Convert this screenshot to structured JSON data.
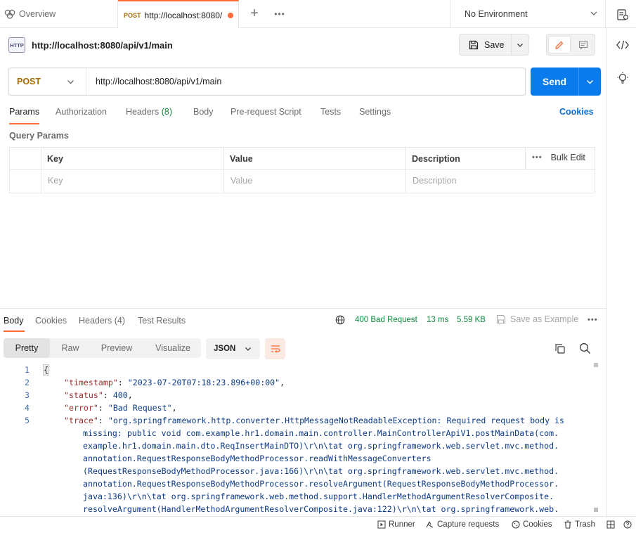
{
  "tabs": {
    "overview_label": "Overview",
    "active_method": "POST",
    "active_url": "http://localhost:8080/",
    "plus": "+",
    "more": "•••"
  },
  "environment": {
    "selected": "No Environment"
  },
  "request": {
    "badge": "HTTP",
    "name": "http://localhost:8080/api/v1/main",
    "save_label": "Save",
    "method": "POST",
    "url": "http://localhost:8080/api/v1/main",
    "send_label": "Send"
  },
  "request_tabs": {
    "params": "Params",
    "authorization": "Authorization",
    "headers": "Headers",
    "headers_count": "(8)",
    "body": "Body",
    "pre_request": "Pre-request Script",
    "tests": "Tests",
    "settings": "Settings",
    "cookies": "Cookies"
  },
  "query_params": {
    "title": "Query Params",
    "col_key": "Key",
    "col_value": "Value",
    "col_description": "Description",
    "bulk_edit": "Bulk Edit",
    "dots": "•••",
    "ph_key": "Key",
    "ph_value": "Value",
    "ph_description": "Description"
  },
  "response_tabs": {
    "body": "Body",
    "cookies": "Cookies",
    "headers": "Headers (4)",
    "test_results": "Test Results"
  },
  "response_meta": {
    "status": "400 Bad Request",
    "time": "13 ms",
    "size": "5.59 KB",
    "save_example": "Save as Example",
    "more": "•••"
  },
  "view_modes": {
    "pretty": "Pretty",
    "raw": "Raw",
    "preview": "Preview",
    "visualize": "Visualize",
    "format": "JSON"
  },
  "code": {
    "line_numbers": [
      "1",
      "2",
      "3",
      "4",
      "5"
    ],
    "l1": "{",
    "l2_key": "\"timestamp\"",
    "l2_val": "\"2023-07-20T07:18:23.896+00:00\"",
    "l3_key": "\"status\"",
    "l3_val": "400",
    "l4_key": "\"error\"",
    "l4_val": "\"Bad Request\"",
    "l5_key": "\"trace\"",
    "l5_wrapped": [
      "\"org.springframework.http.converter.HttpMessageNotReadableException: Required request body is",
      "missing: public void com.example.hr1.domain.main.controller.MainControllerApiV1.postMainData(com.",
      "example.hr1.domain.main.dto.ReqInsertMainDTO)\\r\\n\\tat org.springframework.web.servlet.mvc.method.",
      "annotation.RequestResponseBodyMethodProcessor.readWithMessageConverters",
      "(RequestResponseBodyMethodProcessor.java:166)\\r\\n\\tat org.springframework.web.servlet.mvc.method.",
      "annotation.RequestResponseBodyMethodProcessor.resolveArgument(RequestResponseBodyMethodProcessor.",
      "java:136)\\r\\n\\tat org.springframework.web.method.support.HandlerMethodArgumentResolverComposite.",
      "resolveArgument(HandlerMethodArgumentResolverComposite.java:122)\\r\\n\\tat org.springframework.web."
    ]
  },
  "statusbar": {
    "runner": "Runner",
    "capture": "Capture requests",
    "cookies": "Cookies",
    "trash": "Trash"
  },
  "colors": {
    "accent": "#ff6c37",
    "send": "#097bed",
    "status_ok_text": "#0f8a3c",
    "method_post": "#a46b00"
  }
}
